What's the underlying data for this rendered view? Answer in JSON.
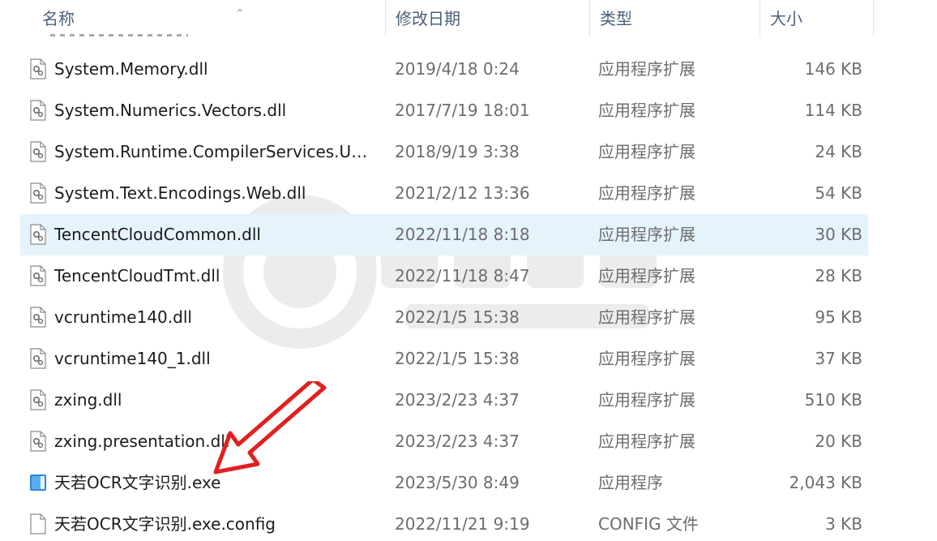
{
  "columns": {
    "name": "名称",
    "date": "修改日期",
    "type": "类型",
    "size": "大小"
  },
  "files": [
    {
      "name": "System.Memory.dll",
      "date": "2019/4/18 0:24",
      "type": "应用程序扩展",
      "size": "146 KB",
      "icon": "dll-icon"
    },
    {
      "name": "System.Numerics.Vectors.dll",
      "date": "2017/7/19 18:01",
      "type": "应用程序扩展",
      "size": "114 KB",
      "icon": "dll-icon"
    },
    {
      "name": "System.Runtime.CompilerServices.Un...",
      "date": "2018/9/19 3:38",
      "type": "应用程序扩展",
      "size": "24 KB",
      "icon": "dll-icon"
    },
    {
      "name": "System.Text.Encodings.Web.dll",
      "date": "2021/2/12 13:36",
      "type": "应用程序扩展",
      "size": "54 KB",
      "icon": "dll-icon"
    },
    {
      "name": "TencentCloudCommon.dll",
      "date": "2022/11/18 8:18",
      "type": "应用程序扩展",
      "size": "30 KB",
      "icon": "dll-icon",
      "selected": true
    },
    {
      "name": "TencentCloudTmt.dll",
      "date": "2022/11/18 8:47",
      "type": "应用程序扩展",
      "size": "28 KB",
      "icon": "dll-icon"
    },
    {
      "name": "vcruntime140.dll",
      "date": "2022/1/5 15:38",
      "type": "应用程序扩展",
      "size": "95 KB",
      "icon": "dll-icon"
    },
    {
      "name": "vcruntime140_1.dll",
      "date": "2022/1/5 15:38",
      "type": "应用程序扩展",
      "size": "37 KB",
      "icon": "dll-icon"
    },
    {
      "name": "zxing.dll",
      "date": "2023/2/23 4:37",
      "type": "应用程序扩展",
      "size": "510 KB",
      "icon": "dll-icon"
    },
    {
      "name": "zxing.presentation.dll",
      "date": "2023/2/23 4:37",
      "type": "应用程序扩展",
      "size": "20 KB",
      "icon": "dll-icon"
    },
    {
      "name": "天若OCR文字识别.exe",
      "date": "2023/5/30 8:49",
      "type": "应用程序",
      "size": "2,043 KB",
      "icon": "exe-icon"
    },
    {
      "name": "天若OCR文字识别.exe.config",
      "date": "2022/11/21 9:19",
      "type": "CONFIG 文件",
      "size": "3 KB",
      "icon": "config-file-icon"
    }
  ],
  "colors": {
    "selection": "#e5f3fb",
    "header_text": "#4c607a",
    "arrow": "#e02020"
  }
}
